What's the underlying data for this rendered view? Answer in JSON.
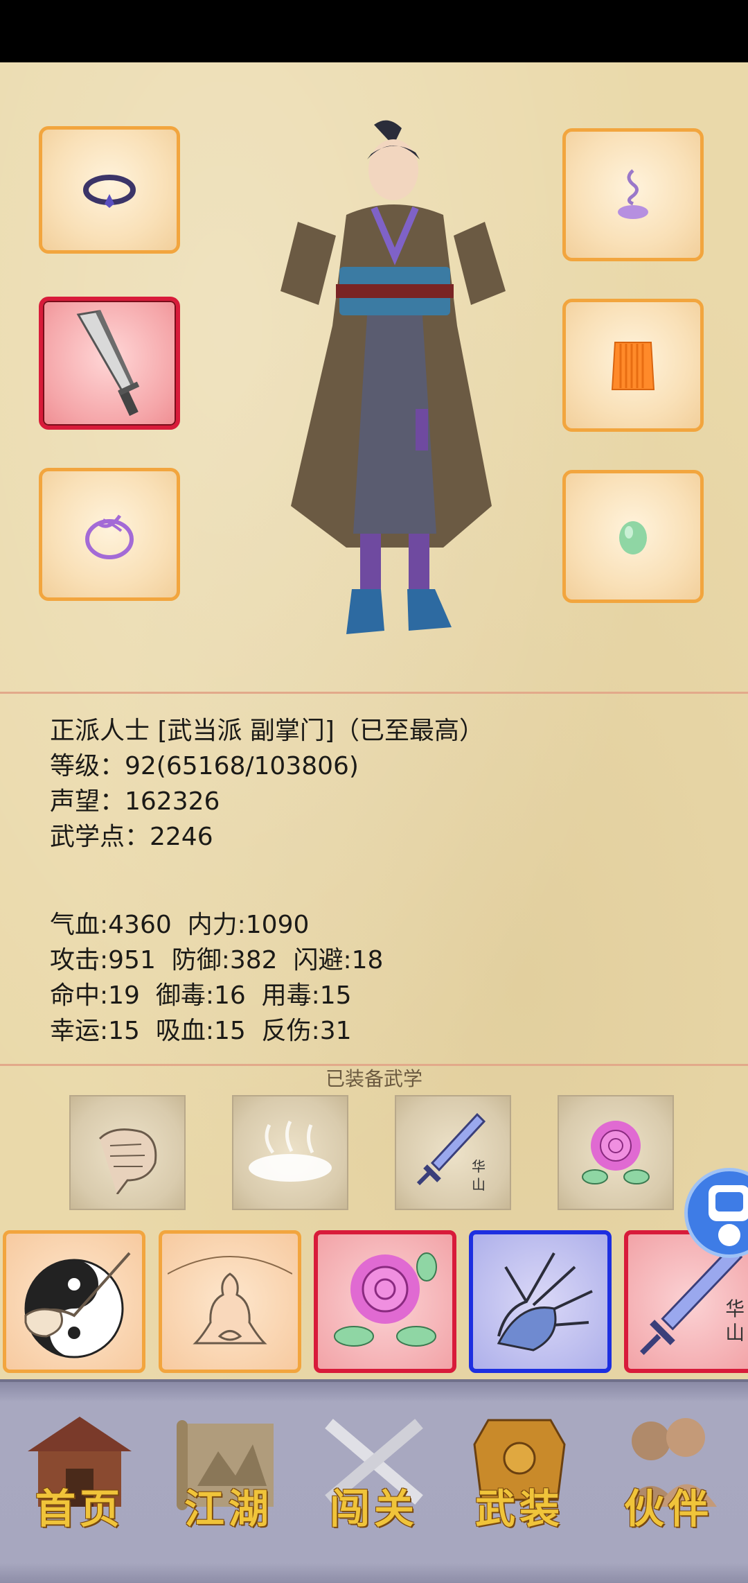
{
  "profile": {
    "title": "正派人士 [武当派 副掌门]（已至最高）",
    "level": "等级：92(65168/103806)",
    "prestige": "声望：162326",
    "martial_points": "武学点：2246"
  },
  "stats": {
    "row1": "气血:4360  内力:1090",
    "row2": "攻击:951  防御:382  闪避:18",
    "row3": "命中:19  御毒:16  用毒:15",
    "row4": "幸运:15  吸血:15  反伤:31"
  },
  "equipped_martial": {
    "title": "已装备武学",
    "tiles": [
      {
        "icon": "fist-icon"
      },
      {
        "icon": "mist-icon"
      },
      {
        "icon": "huashan-sword-icon",
        "label": "华山"
      },
      {
        "icon": "rose-icon"
      }
    ]
  },
  "skills": [
    {
      "icon": "taiji-hand-icon",
      "rarity": "orange"
    },
    {
      "icon": "meditation-icon",
      "rarity": "orange"
    },
    {
      "icon": "rose-icon",
      "rarity": "red"
    },
    {
      "icon": "palm-icon",
      "rarity": "blue"
    },
    {
      "icon": "huashan-sword-icon",
      "rarity": "red",
      "label": "华山"
    }
  ],
  "nav": {
    "home": "首页",
    "jianghu": "江湖",
    "challenge": "闯关",
    "equipment": "武装",
    "partner": "伙伴"
  },
  "colors": {
    "slot_border": "#f2a53e",
    "rare_border": "#d81b3a",
    "epic_border": "#1d2fe0",
    "nav_text": "#f0c43a"
  }
}
